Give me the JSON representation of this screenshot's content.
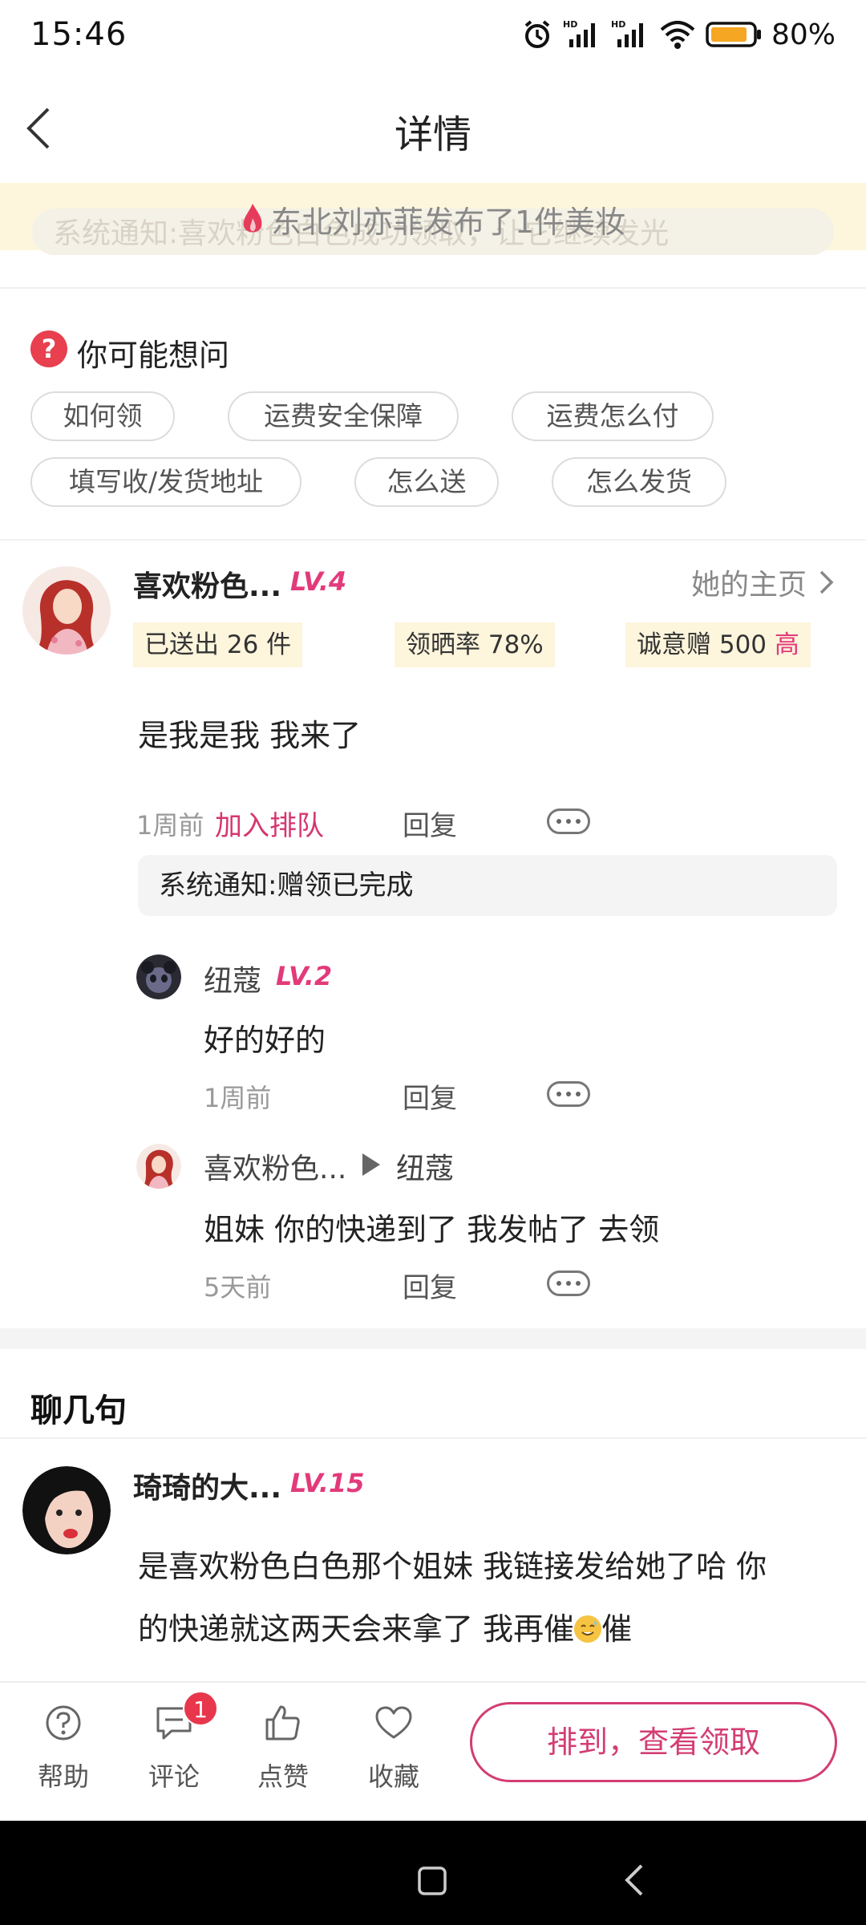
{
  "status_bar": {
    "time": "15:46",
    "battery": "80%",
    "icons": [
      "alarm-icon",
      "signal-hd-icon",
      "signal-hd-icon",
      "wifi-icon",
      "battery-icon"
    ]
  },
  "nav": {
    "title": "详情"
  },
  "banner": {
    "ghost_text": "系统通知:喜欢粉色白色成功领取，让它继续发光",
    "text": "东北刘亦菲发布了1件美妆"
  },
  "faq": {
    "title": "你可能想问",
    "chips": [
      "如何领",
      "运费安全保障",
      "运费怎么付",
      "填写收/发货地址",
      "怎么送",
      "怎么发货"
    ]
  },
  "post": {
    "username": "喜欢粉色...",
    "level": "LV.4",
    "home_link": "她的主页",
    "stats": {
      "sent": "已送出 26 件",
      "rate": "领晒率 78%",
      "gift_prefix": "诚意赠 500",
      "gift_level": "高"
    },
    "content": "是我是我 我来了",
    "time": "1周前",
    "queue_link": "加入排队",
    "reply": "回复",
    "system_notice": "系统通知:赠领已完成",
    "replies": [
      {
        "name": "纽蔻",
        "level": "LV.2",
        "content": "好的好的",
        "time": "1周前",
        "reply": "回复"
      },
      {
        "name": "喜欢粉色...",
        "to": "纽蔻",
        "content": "姐妹 你的快递到了  我发帖了 去领",
        "time": "5天前",
        "reply": "回复"
      }
    ]
  },
  "chat": {
    "title": "聊几句",
    "comment": {
      "username": "琦琦的大...",
      "level": "LV.15",
      "line1": "是喜欢粉色白色那个姐妹 我链接发给她了哈 你",
      "line2a": "的快递就这两天会来拿了 我再催",
      "line2b": "催"
    }
  },
  "bottom_bar": {
    "help": "帮助",
    "comment": "评论",
    "comment_badge": "1",
    "like": "点赞",
    "favorite": "收藏",
    "cta": "排到，查看领取"
  }
}
